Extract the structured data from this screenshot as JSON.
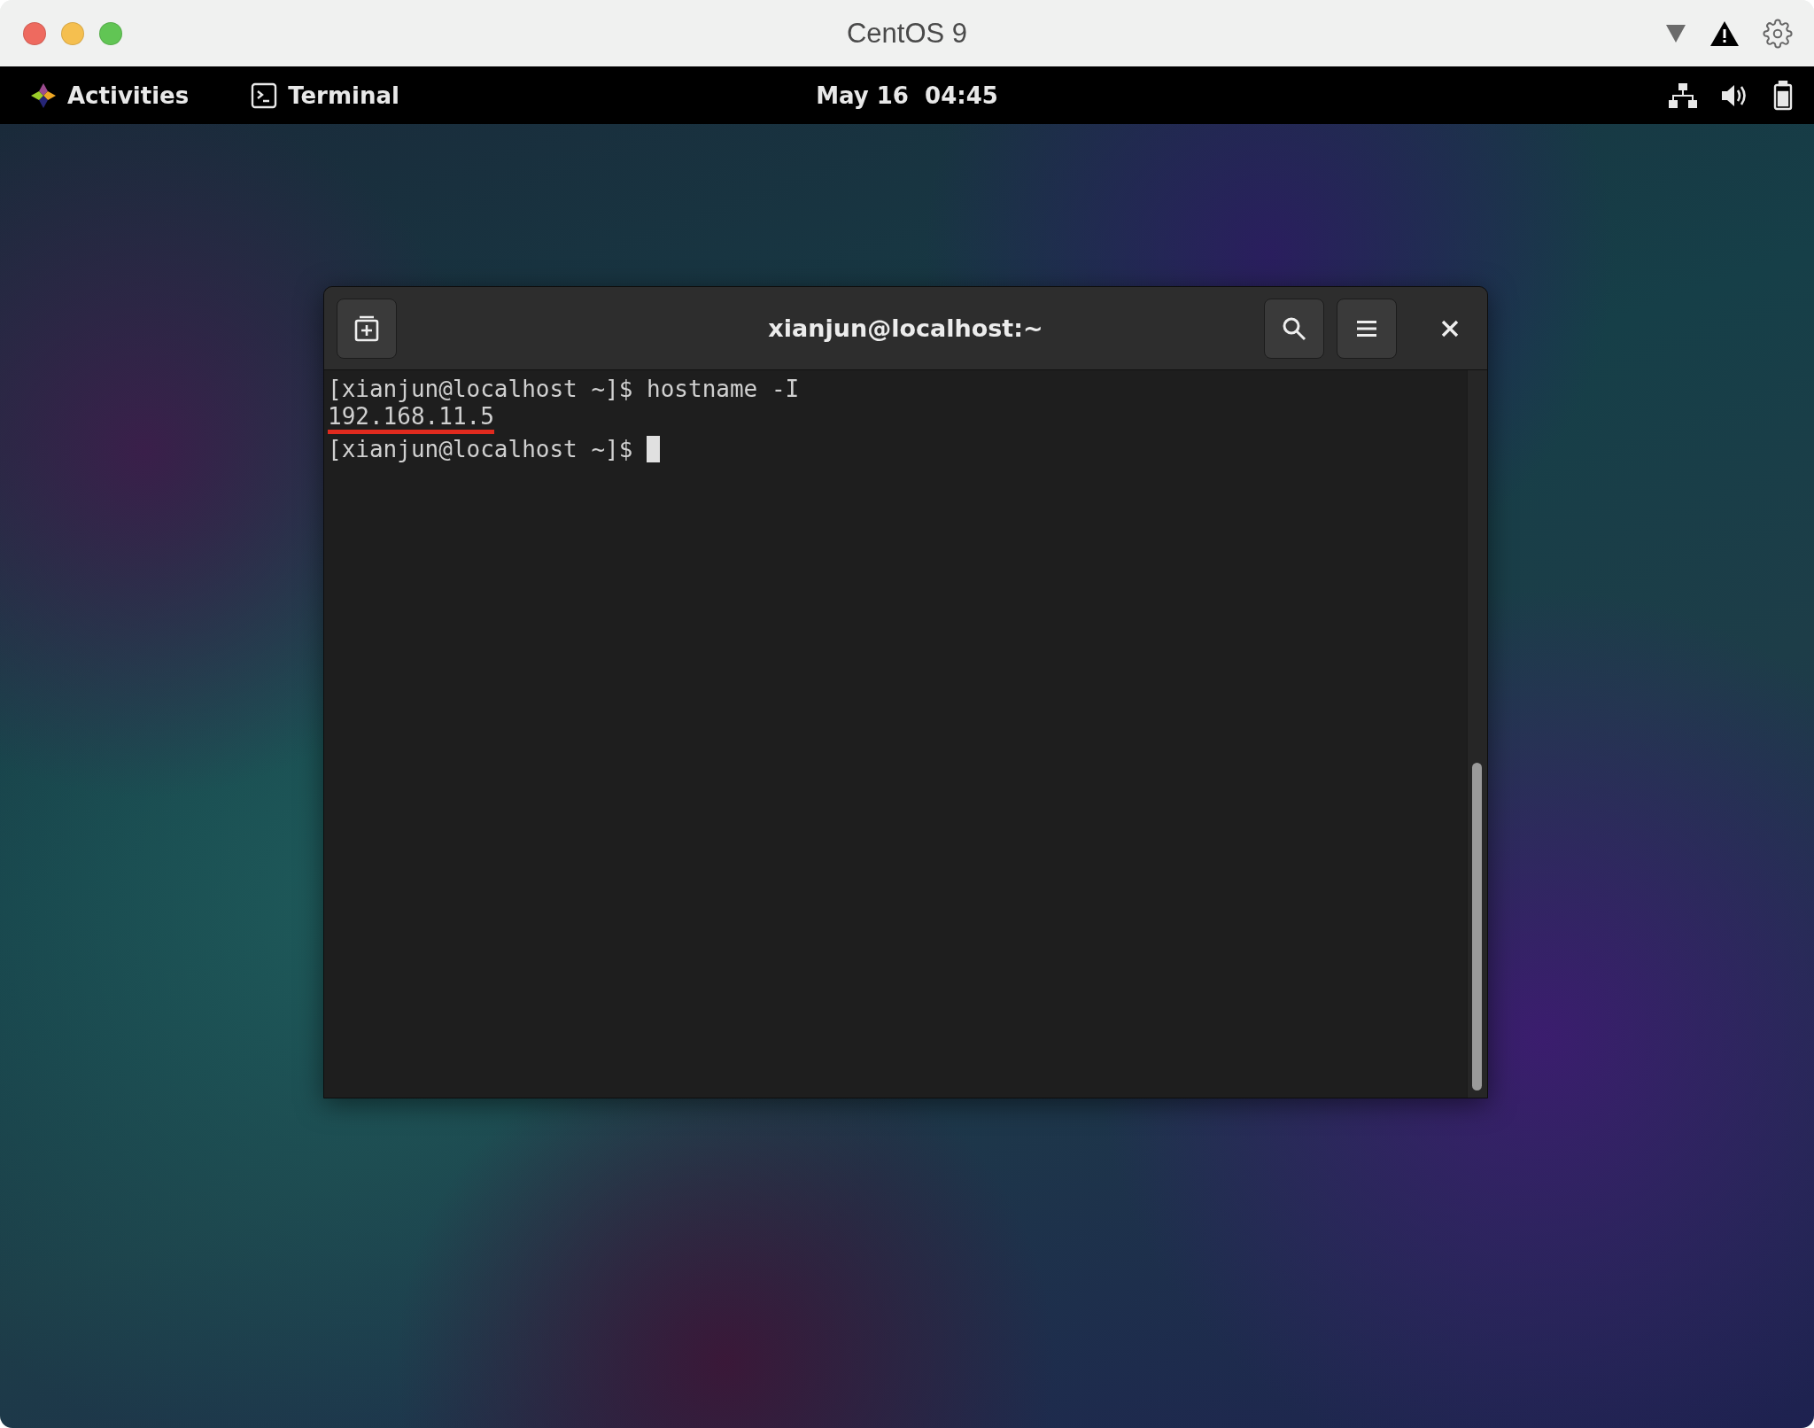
{
  "window": {
    "title": "CentOS 9"
  },
  "top_bar": {
    "activities": "Activities",
    "app": "Terminal",
    "clock": "May 16  04:45"
  },
  "terminal": {
    "title": "xianjun@localhost:~",
    "lines": [
      {
        "text": "[xianjun@localhost ~]$ hostname -I",
        "underlined": false,
        "cursor": false
      },
      {
        "text": "192.168.11.5",
        "underlined": true,
        "cursor": false
      },
      {
        "text": "[xianjun@localhost ~]$ ",
        "underlined": false,
        "cursor": true
      }
    ]
  }
}
